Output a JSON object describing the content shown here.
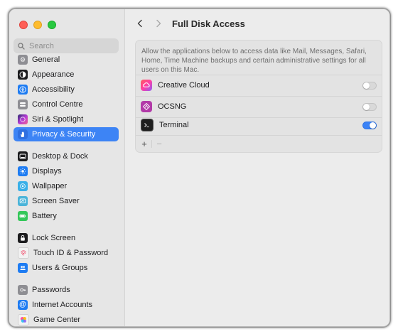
{
  "window": {
    "search": {
      "placeholder": "Search"
    },
    "sidebar": {
      "items": [
        {
          "label": "General",
          "icon": "gear-icon",
          "color": "#8e8e93"
        },
        {
          "label": "Appearance",
          "icon": "appearance-icon",
          "color": "#1c1c1e"
        },
        {
          "label": "Accessibility",
          "icon": "accessibility-icon",
          "color": "#1e7cf2"
        },
        {
          "label": "Control Centre",
          "icon": "control-centre-icon",
          "color": "#8e8e93"
        },
        {
          "label": "Siri & Spotlight",
          "icon": "siri-icon",
          "color": "#3b3b8f"
        },
        {
          "label": "Privacy & Security",
          "icon": "hand-icon",
          "color": "#3d84f5",
          "selected": true
        },
        {
          "label": "Desktop & Dock",
          "icon": "dock-icon",
          "color": "#1c1c1e"
        },
        {
          "label": "Displays",
          "icon": "sun-icon",
          "color": "#1e7cf2"
        },
        {
          "label": "Wallpaper",
          "icon": "wallpaper-icon",
          "color": "#3ab0e8"
        },
        {
          "label": "Screen Saver",
          "icon": "screen-saver-icon",
          "color": "#4bb4d9"
        },
        {
          "label": "Battery",
          "icon": "battery-icon",
          "color": "#34c759"
        },
        {
          "label": "Lock Screen",
          "icon": "lock-icon",
          "color": "#1c1c1e"
        },
        {
          "label": "Touch ID & Password",
          "icon": "fingerprint-icon",
          "color": "#f2f2f2"
        },
        {
          "label": "Users & Groups",
          "icon": "users-icon",
          "color": "#1e7cf2"
        },
        {
          "label": "Passwords",
          "icon": "key-icon",
          "color": "#8e8e93"
        },
        {
          "label": "Internet Accounts",
          "icon": "at-icon",
          "color": "#1e7cf2"
        },
        {
          "label": "Game Center",
          "icon": "game-center-icon",
          "color": "#f2f2f2"
        }
      ]
    },
    "main": {
      "title": "Full Disk Access",
      "description": "Allow the applications below to access data like Mail, Messages, Safari, Home, Time Machine backups and certain administrative settings for all users on this Mac.",
      "apps": [
        {
          "label": "Creative Cloud",
          "icon": "creative-cloud-icon",
          "enabled": false
        },
        {
          "label": "OCSNG",
          "icon": "ocsng-icon",
          "enabled": false
        },
        {
          "label": "Terminal",
          "icon": "terminal-icon",
          "enabled": true
        }
      ],
      "add_symbol": "+",
      "remove_symbol": "−"
    },
    "accent_color": "#3d84f5"
  }
}
